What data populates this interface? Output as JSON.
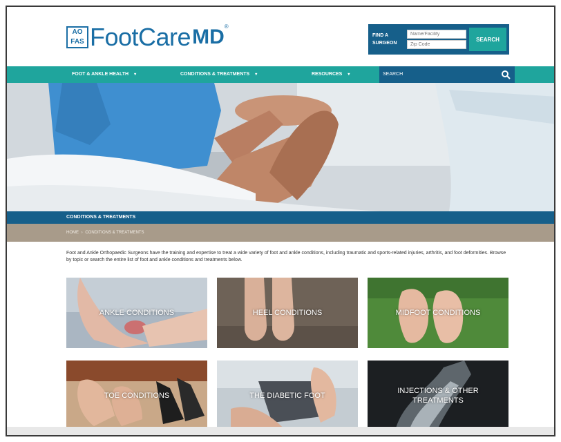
{
  "header": {
    "logo": {
      "mark_letters": [
        "AO",
        "FAS"
      ],
      "name_part1": "FootCare",
      "name_part2": "MD",
      "registered": "®"
    },
    "find_surgeon": {
      "label": "FIND A SURGEON",
      "name_placeholder": "Name/Facility",
      "zip_placeholder": "Zip Code",
      "button": "SEARCH"
    }
  },
  "nav": {
    "items": [
      {
        "label": "FOOT & ANKLE HEALTH"
      },
      {
        "label": "CONDITIONS & TREATMENTS"
      },
      {
        "label": "RESOURCES"
      }
    ],
    "search_label": "SEARCH"
  },
  "section_title": "CONDITIONS & TREATMENTS",
  "breadcrumb": {
    "home": "HOME",
    "separator": "›",
    "current": "CONDITIONS & TREATMENTS"
  },
  "intro_text": "Foot and Ankle Orthopaedic Surgeons have the training and expertise to treat a wide variety of foot and ankle conditions, including traumatic and sports-related injuries, arthritis, and foot deformities. Browse by topic or search the entire list of foot and ankle conditions and treatments below.",
  "tiles": [
    {
      "label": "ANKLE CONDITIONS"
    },
    {
      "label": "HEEL CONDITIONS"
    },
    {
      "label": "MIDFOOT CONDITIONS"
    },
    {
      "label": "TOE CONDITIONS"
    },
    {
      "label": "THE DIABETIC FOOT"
    },
    {
      "label": "INJECTIONS & OTHER TREATMENTS"
    }
  ],
  "colors": {
    "brand_blue": "#1a6ea5",
    "dark_blue": "#165f8a",
    "teal": "#1fa59d",
    "taupe": "#a89b8a"
  }
}
